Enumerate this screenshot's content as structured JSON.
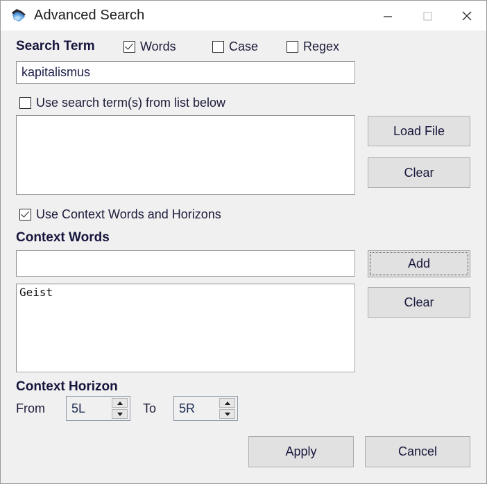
{
  "window": {
    "title": "Advanced Search",
    "icon": "app-icon",
    "controls": {
      "minimize": "minimize-icon",
      "maximize": "maximize-icon",
      "close": "close-icon"
    }
  },
  "search_term": {
    "label": "Search Term",
    "options": [
      {
        "label": "Words",
        "checked": true
      },
      {
        "label": "Case",
        "checked": false
      },
      {
        "label": "Regex",
        "checked": false
      }
    ],
    "input_value": "kapitalismus",
    "input_placeholder": "",
    "use_list_checkbox": {
      "label": "Use search term(s) from list below",
      "checked": false
    },
    "list_items": [],
    "buttons": {
      "load_file": "Load File",
      "clear": "Clear"
    }
  },
  "context": {
    "use_context_checkbox": {
      "label": "Use Context Words and Horizons",
      "checked": true
    },
    "words_label": "Context Words",
    "input_value": "",
    "input_placeholder": "",
    "list_items": [
      "Geist"
    ],
    "buttons": {
      "add": "Add",
      "clear": "Clear"
    }
  },
  "horizon": {
    "label": "Context Horizon",
    "from_label": "From",
    "from_value": "5L",
    "to_label": "To",
    "to_value": "5R"
  },
  "footer": {
    "apply": "Apply",
    "cancel": "Cancel"
  },
  "colors": {
    "dialog_bg": "#f0f0f0",
    "titlebar_bg": "#ffffff",
    "button_bg": "#e1e1e1",
    "field_bg": "#ffffff",
    "text": "#1b1b3a"
  }
}
